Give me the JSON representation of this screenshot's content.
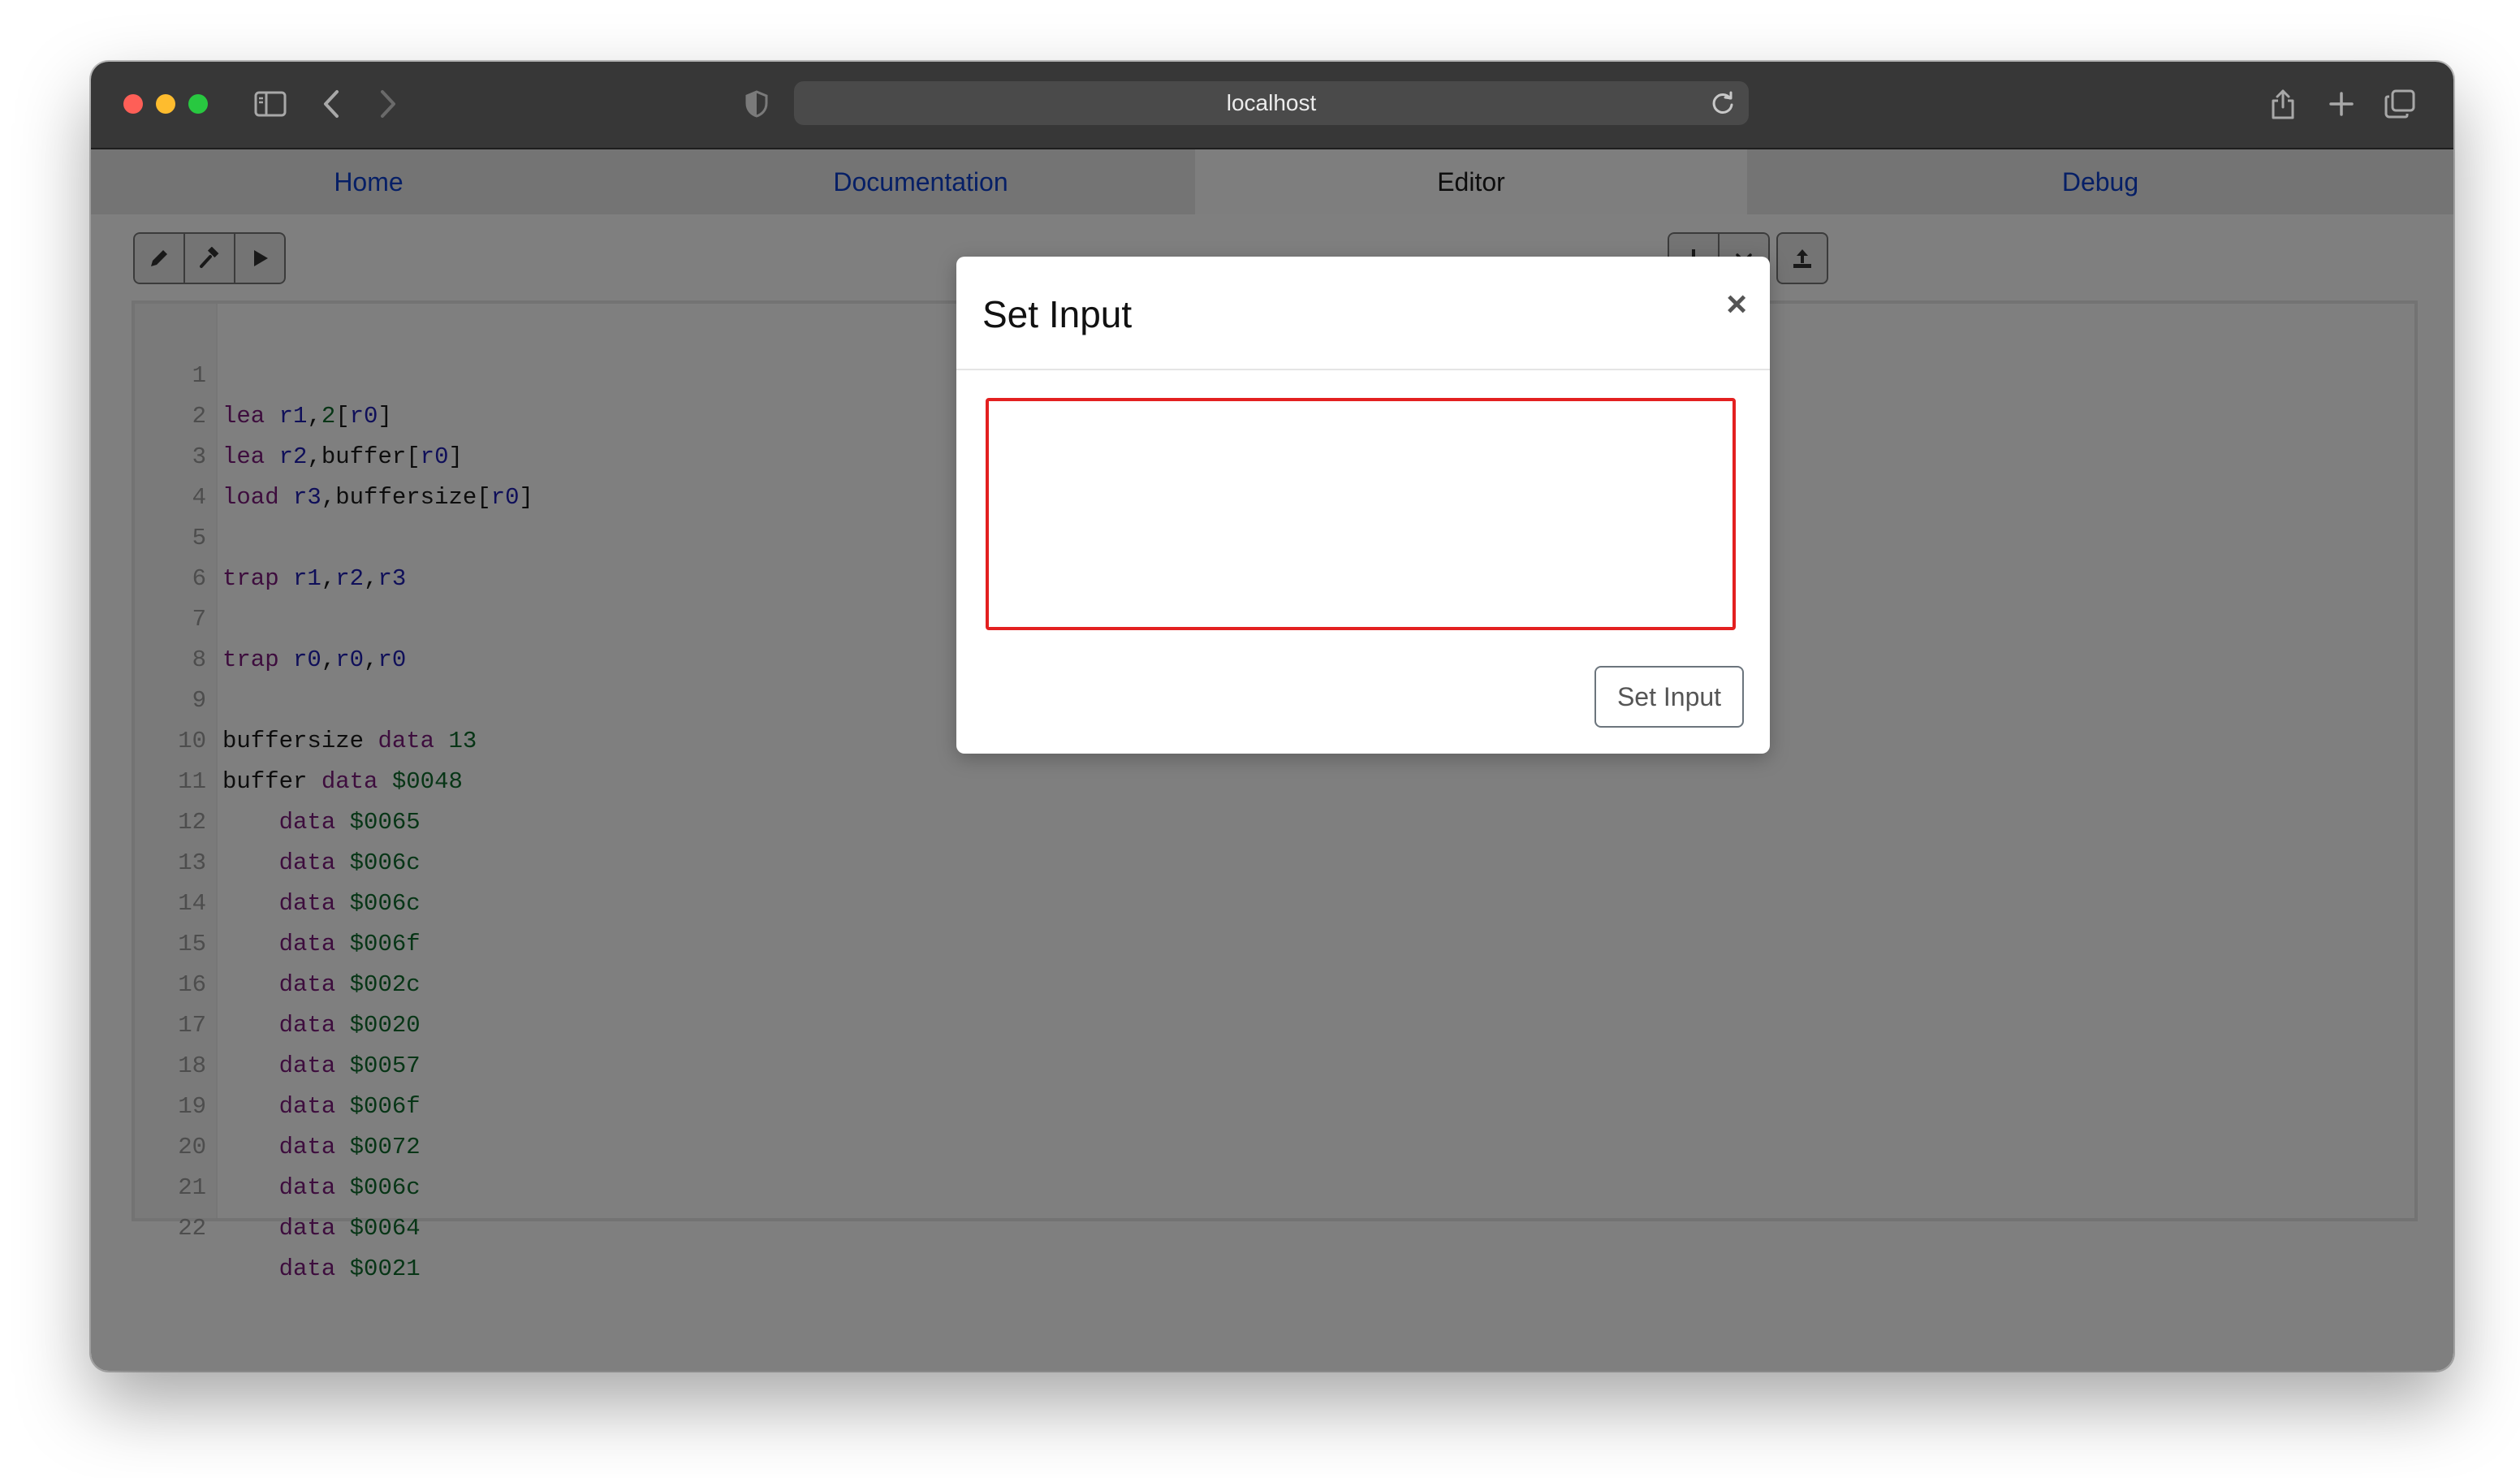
{
  "browser": {
    "url": "localhost"
  },
  "nav": {
    "tabs": [
      {
        "label": "Home"
      },
      {
        "label": "Documentation"
      },
      {
        "label": "Editor"
      },
      {
        "label": "Debug"
      }
    ],
    "active": "Editor"
  },
  "toolbar": {
    "left_icons": [
      "pencil-icon",
      "hammer-icon",
      "play-icon"
    ],
    "right_icons": [
      "download-icon",
      "chevron-down-icon",
      "upload-icon"
    ]
  },
  "editor": {
    "lines": [
      {
        "num": "1"
      },
      {
        "num": "2"
      },
      {
        "num": "3"
      },
      {
        "num": "4"
      },
      {
        "num": "5"
      },
      {
        "num": "6"
      },
      {
        "num": "7"
      },
      {
        "num": "8"
      },
      {
        "num": "9"
      },
      {
        "num": "10"
      },
      {
        "num": "11"
      },
      {
        "num": "12"
      },
      {
        "num": "13"
      },
      {
        "num": "14"
      },
      {
        "num": "15"
      },
      {
        "num": "16"
      },
      {
        "num": "17"
      },
      {
        "num": "18"
      },
      {
        "num": "19"
      },
      {
        "num": "20"
      },
      {
        "num": "21"
      },
      {
        "num": "22"
      }
    ],
    "code": {
      "l1": [
        "lea",
        "r1",
        ",",
        "2",
        "[",
        "r0",
        "]"
      ],
      "l2": [
        "lea",
        "r2",
        ",buffer[",
        "r0",
        "]"
      ],
      "l3": [
        "load",
        "r3",
        ",buffersize[",
        "r0",
        "]"
      ],
      "l5": [
        "trap",
        "r1",
        ",",
        "r2",
        ",",
        "r3"
      ],
      "l7": [
        "trap",
        "r0",
        ",",
        "r0",
        ",",
        "r0"
      ],
      "l9": [
        "buffersize",
        "data",
        "13"
      ],
      "l10": [
        "buffer",
        "data",
        "$0048"
      ],
      "data_values": [
        "$0065",
        "$006c",
        "$006c",
        "$006f",
        "$002c",
        "$0020",
        "$0057",
        "$006f",
        "$0072",
        "$006c",
        "$0064",
        "$0021"
      ],
      "data_kw": "data"
    }
  },
  "modal": {
    "title": "Set Input",
    "close": "×",
    "input_value": "",
    "submit_label": "Set Input"
  }
}
